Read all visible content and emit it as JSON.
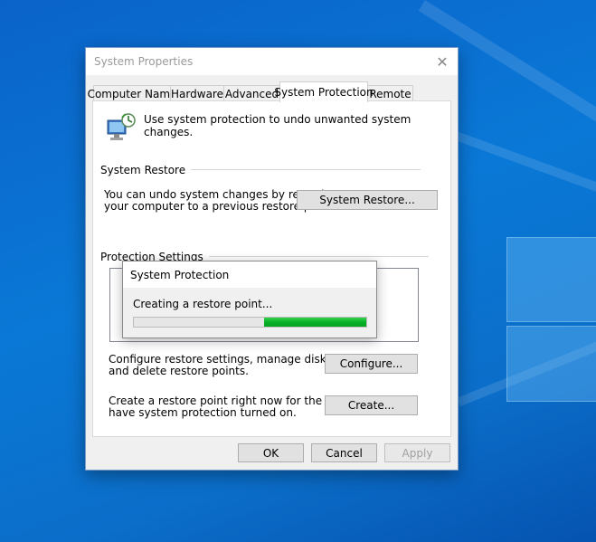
{
  "window": {
    "title": "System Properties",
    "close_glyph": "✕"
  },
  "tabs": [
    {
      "label": "Computer Name"
    },
    {
      "label": "Hardware"
    },
    {
      "label": "Advanced"
    },
    {
      "label": "System Protection"
    },
    {
      "label": "Remote"
    }
  ],
  "active_tab": "System Protection",
  "intro": {
    "icon": "system-protection-icon",
    "text": "Use system protection to undo unwanted system changes."
  },
  "system_restore": {
    "group_label": "System Restore",
    "description_line1": "You can undo system changes by reverting",
    "description_line2": "your computer to a previous restore point.",
    "button_label": "System Restore..."
  },
  "protection_settings": {
    "group_label": "Protection Settings",
    "configure_text_line1": "Configure restore settings, manage disk space,",
    "configure_text_line2": "and delete restore points.",
    "configure_button": "Configure...",
    "create_text_line1": "Create a restore point right now for the drives that",
    "create_text_line2": "have system protection turned on.",
    "create_button": "Create..."
  },
  "footer": {
    "ok": "OK",
    "cancel": "Cancel",
    "apply": "Apply"
  },
  "progress_dialog": {
    "title": "System Protection",
    "status": "Creating a restore point...",
    "marquee_fill_start": 0.56,
    "marquee_fill_end": 1.0,
    "bar_color": "#06b025"
  },
  "colors": {
    "desktop_accent": "#0a78d6"
  }
}
